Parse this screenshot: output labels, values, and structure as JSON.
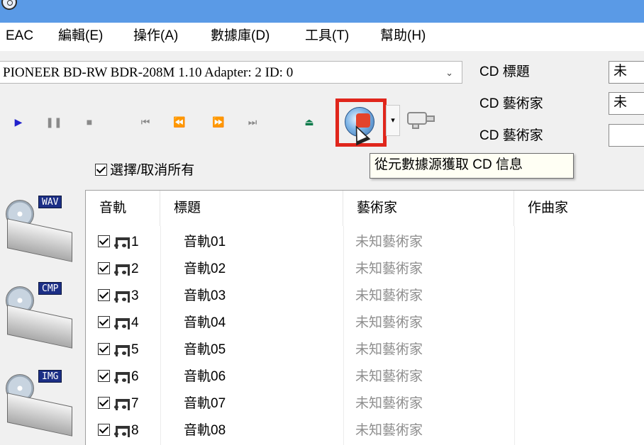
{
  "menu": {
    "items": [
      "EAC",
      "編輯(E)",
      "操作(A)",
      "數據庫(D)",
      "工具(T)",
      "幫助(H)"
    ]
  },
  "drive": {
    "selected": "PIONEER BD-RW   BDR-208M 1.10   Adapter: 2  ID: 0"
  },
  "cd_info": {
    "title_label": "CD 標題",
    "title_value": "未",
    "artist_label": "CD 藝術家",
    "artist_value": "未",
    "artist2_label": "CD 藝術家",
    "artist2_value": ""
  },
  "toolbar": {
    "icons": [
      "play-icon",
      "pause-icon",
      "stop-icon",
      "prev-track-icon",
      "rewind-icon",
      "fast-forward-icon",
      "next-track-icon",
      "eject-icon",
      "metadata-fetch-icon",
      "network-icon"
    ]
  },
  "tooltip": {
    "text": "從元數據源獲取 CD 信息"
  },
  "select_all": {
    "label": "選擇/取消所有"
  },
  "side_buttons": {
    "wav": "WAV",
    "cmp": "CMP",
    "img": "IMG"
  },
  "table": {
    "headers": [
      "音軌",
      "標題",
      "藝術家",
      "作曲家"
    ],
    "rows": [
      {
        "track": "1",
        "title": "音軌01",
        "artist": "未知藝術家",
        "composer": ""
      },
      {
        "track": "2",
        "title": "音軌02",
        "artist": "未知藝術家",
        "composer": ""
      },
      {
        "track": "3",
        "title": "音軌03",
        "artist": "未知藝術家",
        "composer": ""
      },
      {
        "track": "4",
        "title": "音軌04",
        "artist": "未知藝術家",
        "composer": ""
      },
      {
        "track": "5",
        "title": "音軌05",
        "artist": "未知藝術家",
        "composer": ""
      },
      {
        "track": "6",
        "title": "音軌06",
        "artist": "未知藝術家",
        "composer": ""
      },
      {
        "track": "7",
        "title": "音軌07",
        "artist": "未知藝術家",
        "composer": ""
      },
      {
        "track": "8",
        "title": "音軌08",
        "artist": "未知藝術家",
        "composer": ""
      }
    ]
  },
  "colors": {
    "titlebar": "#5a9ae6",
    "highlight_box": "#e0261c",
    "artist_text": "#8e8e8e"
  }
}
